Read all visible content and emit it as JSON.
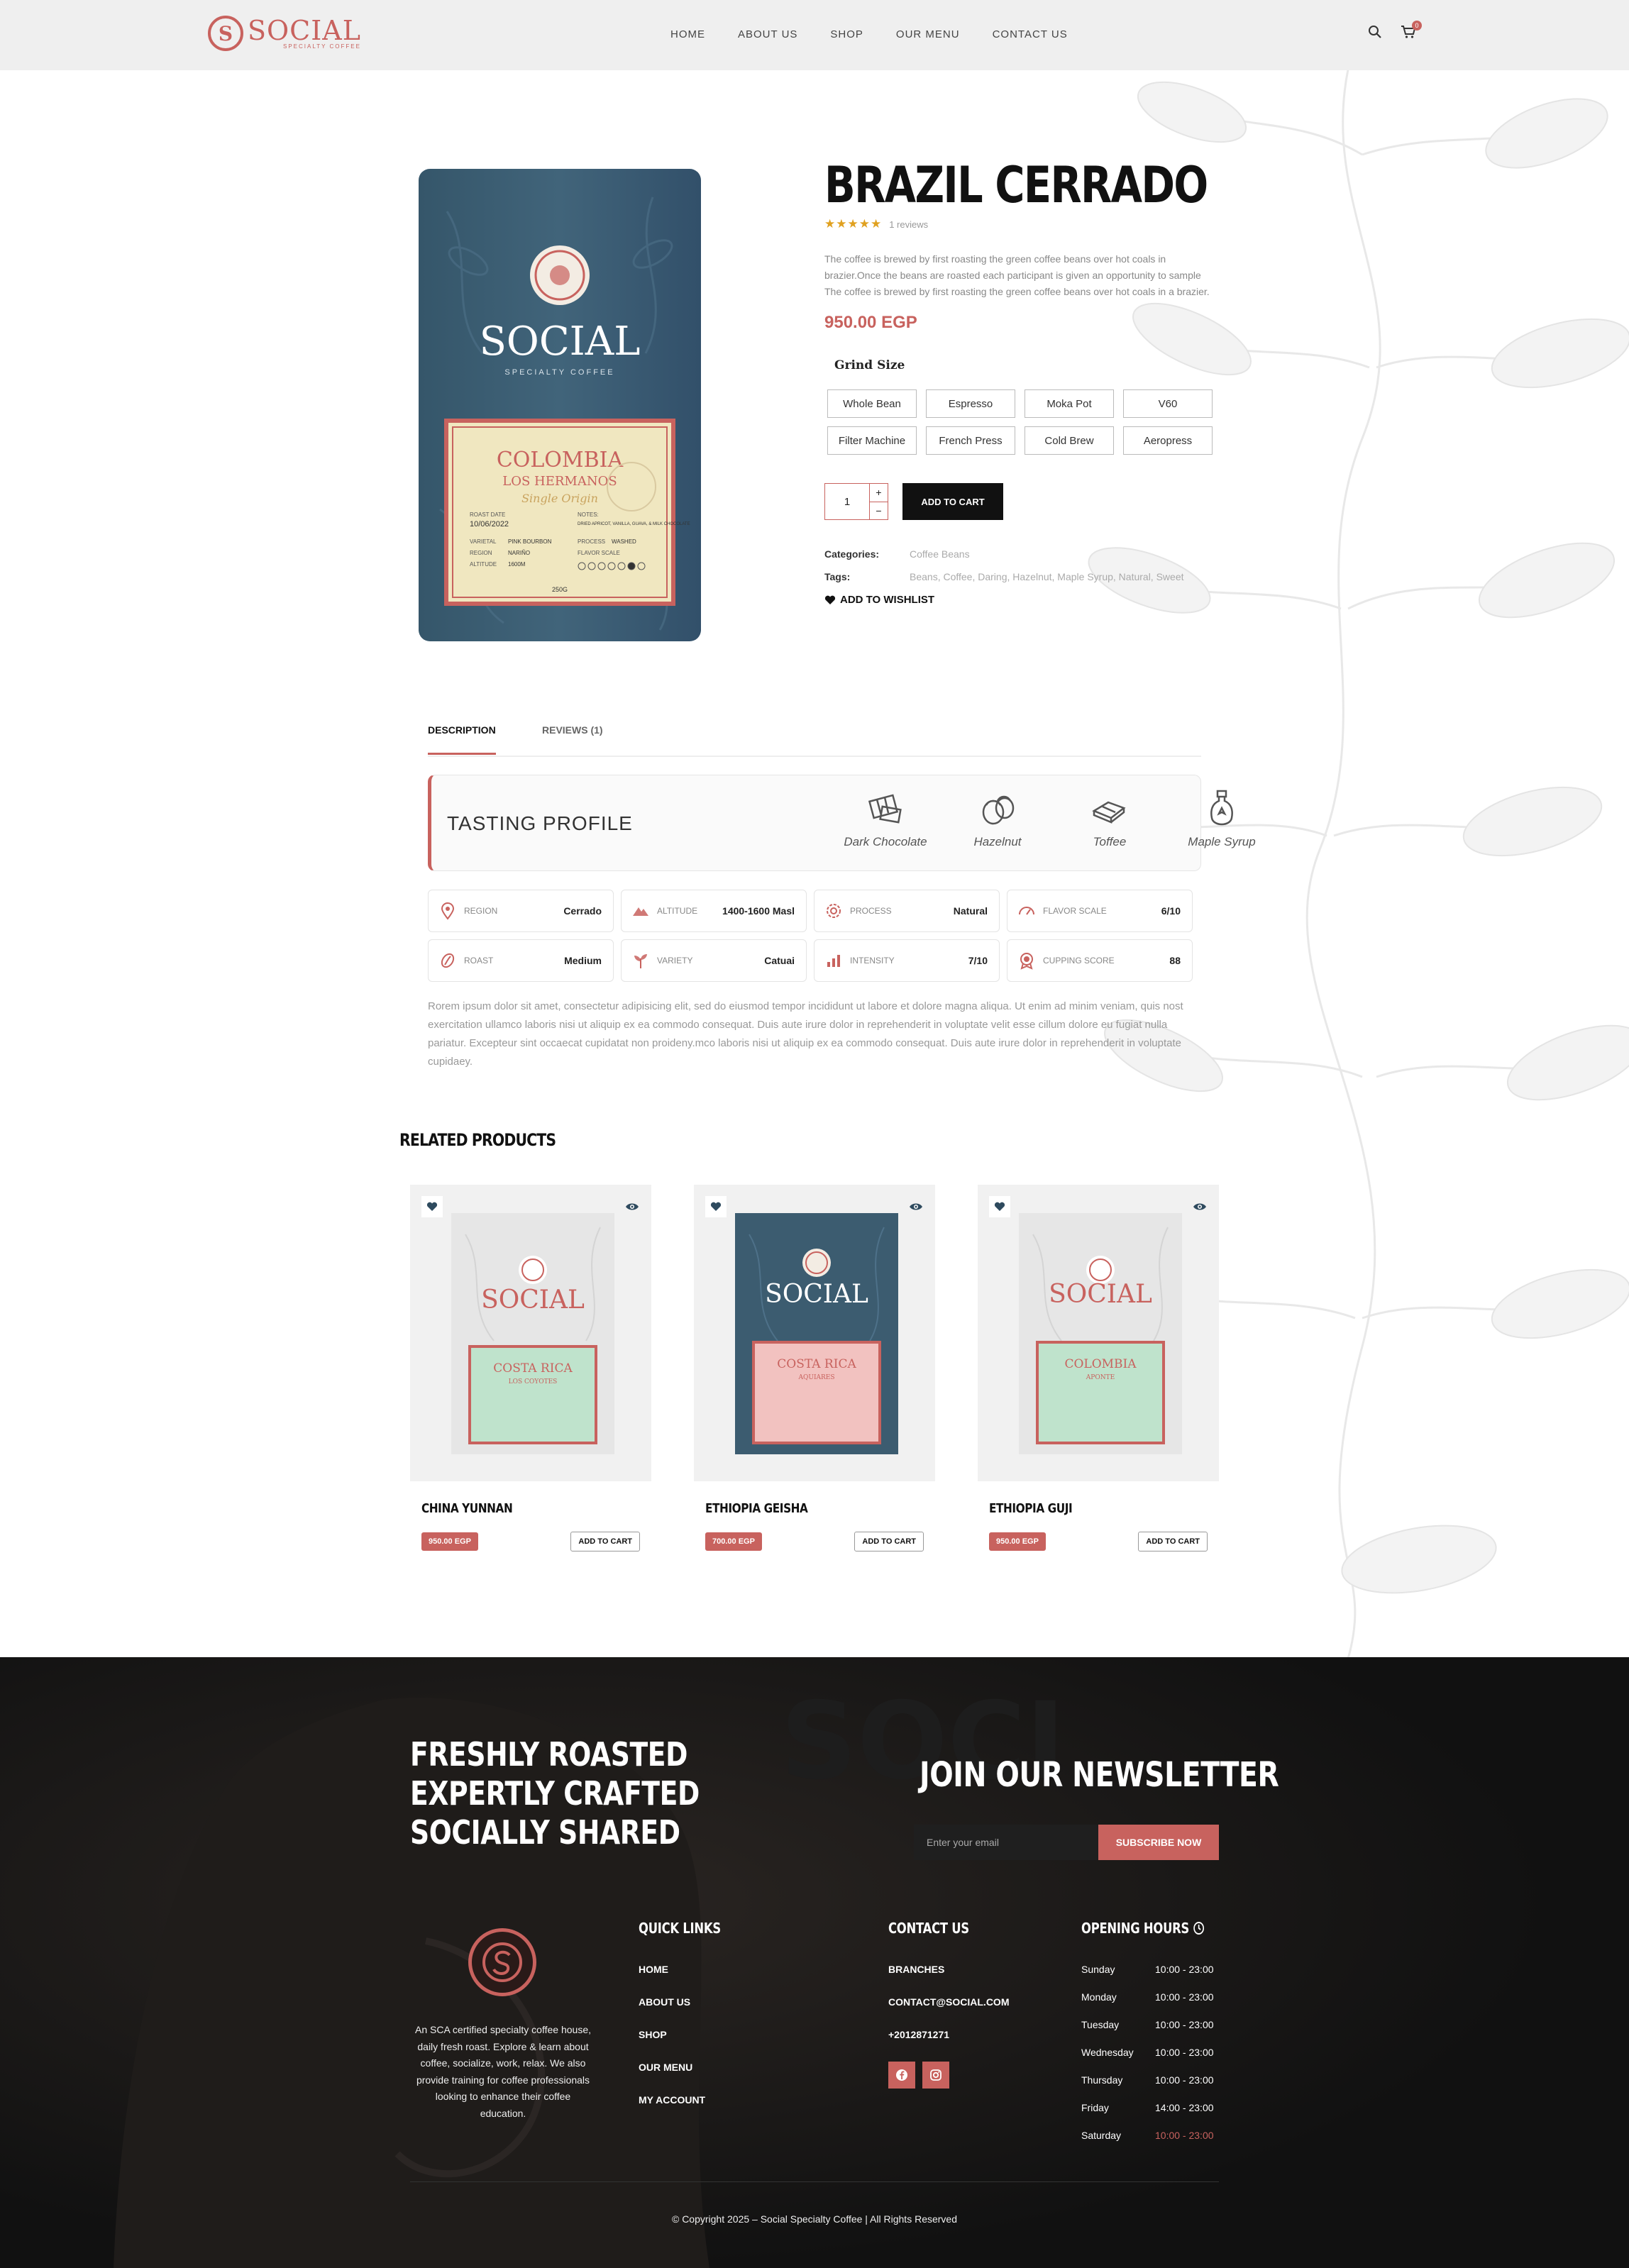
{
  "colors": {
    "accent": "#c8625e",
    "dark": "#111111",
    "star": "#e0a120",
    "bag_blue": "#3c5c70",
    "label_cream": "#f0e7c0",
    "footer_bg": "#141414"
  },
  "header": {
    "brand": "SOCIAL",
    "brand_sub": "SPECIALTY COFFEE",
    "nav": [
      "HOME",
      "ABOUT US",
      "SHOP",
      "OUR MENU",
      "CONTACT US"
    ],
    "cart_count": "0",
    "icons": [
      "search-icon",
      "cart-icon"
    ]
  },
  "product": {
    "title": "BRAZIL CERRADO",
    "stars": "★★★★★",
    "reviews": "1 reviews",
    "short_description": "The coffee is brewed by first roasting the green coffee beans over hot coals in brazier.Once the beans are roasted each participant is given an opportunity to sample The coffee is brewed by first roasting the green coffee beans over hot coals in a brazier.",
    "price": "950.00 EGP",
    "grind_label": "Grind Size",
    "grind_options": [
      "Whole Bean",
      "Espresso",
      "Moka Pot",
      "V60",
      "Filter Machine",
      "French Press",
      "Cold Brew",
      "Aeropress"
    ],
    "quantity": "1",
    "qty_plus": "+",
    "qty_minus": "−",
    "add_to_cart": "ADD TO CART",
    "categories_label": "Categories:",
    "categories": "Coffee Beans",
    "tags_label": "Tags:",
    "tags": "Beans, Coffee, Daring, Hazelnut, Maple Syrup, Natural, Sweet",
    "wishlist": "ADD TO WISHLIST",
    "bag": {
      "brand": "SOCIAL",
      "brand_sub": "SPECIALTY COFFEE",
      "label_title": "COLOMBIA",
      "label_sub": "LOS HERMANOS",
      "label_script": "Single Origin",
      "roast_date_label": "ROAST DATE",
      "roast_date": "10/06/2022",
      "notes_label": "NOTES:",
      "notes": "DRIED APRICOT, VANILLA, GUAVA, & MILK CHOCOLATE",
      "varietal_label": "VARIETAL",
      "varietal": "PINK BOURBON",
      "region_label": "REGION",
      "region": "NARIÑO",
      "altitude_label": "ALTITUDE",
      "altitude": "1600M",
      "process_label": "PROCESS",
      "process": "WASHED",
      "flavor_label": "FLAVOR SCALE",
      "weight": "250G"
    }
  },
  "tabs": [
    {
      "label": "DESCRIPTION",
      "active": true
    },
    {
      "label": "REVIEWS (1)",
      "active": false
    }
  ],
  "tasting": {
    "title": "TASTING PROFILE",
    "notes": [
      {
        "label": "Dark Chocolate",
        "icon": "chocolate-icon"
      },
      {
        "label": "Hazelnut",
        "icon": "hazelnut-icon"
      },
      {
        "label": "Toffee",
        "icon": "toffee-icon"
      },
      {
        "label": "Maple Syrup",
        "icon": "maple-syrup-icon"
      }
    ]
  },
  "attributes": [
    {
      "key": "REGION",
      "value": "Cerrado",
      "icon": "location-icon"
    },
    {
      "key": "ALTITUDE",
      "value": "1400-1600 Masl",
      "icon": "mountain-icon"
    },
    {
      "key": "PROCESS",
      "value": "Natural",
      "icon": "process-icon"
    },
    {
      "key": "FLAVOR SCALE",
      "value": "6/10",
      "icon": "scale-icon"
    },
    {
      "key": "ROAST",
      "value": "Medium",
      "icon": "bean-icon"
    },
    {
      "key": "VARIETY",
      "value": "Catuai",
      "icon": "plant-icon"
    },
    {
      "key": "INTENSITY",
      "value": "7/10",
      "icon": "chart-icon"
    },
    {
      "key": "CUPPING SCORE",
      "value": "88",
      "icon": "badge-icon"
    }
  ],
  "description": "Rorem ipsum dolor sit amet, consectetur adipisicing elit, sed do eiusmod tempor incididunt ut labore et dolore magna aliqua. Ut enim ad minim veniam, quis nost exercitation ullamco laboris nisi ut aliquip ex ea commodo consequat. Duis aute irure dolor in reprehenderit in voluptate velit esse cillum dolore eu fugiat nulla pariatur. Excepteur sint occaecat cupidatat non proideny.mco laboris nisi ut aliquip ex ea commodo consequat. Duis aute irure dolor in reprehenderit in voluptate cupidaey.",
  "related": {
    "title": "RELATED PRODUCTS",
    "items": [
      {
        "name": "CHINA YUNNAN",
        "price": "950.00 EGP",
        "add": "ADD TO CART",
        "bag_style": "white",
        "label_color": "#bfe3cc",
        "label_title": "COSTA RICA",
        "label_sub": "LOS COYOTES"
      },
      {
        "name": "ETHIOPIA GEISHA",
        "price": "700.00 EGP",
        "add": "ADD TO CART",
        "bag_style": "blue",
        "label_color": "#f2c2c0",
        "label_title": "COSTA RICA",
        "label_sub": "AQUIARES"
      },
      {
        "name": "ETHIOPIA GUJI",
        "price": "950.00 EGP",
        "add": "ADD TO CART",
        "bag_style": "white",
        "label_color": "#bfe3cc",
        "label_title": "COLOMBIA",
        "label_sub": "APONTE"
      }
    ]
  },
  "footer": {
    "slogan": [
      "FRESHLY ROASTED",
      "EXPERTLY CRAFTED",
      "SOCIALLY SHARED"
    ],
    "newsletter_title": "JOIN OUR NEWSLETTER",
    "email_placeholder": "Enter your email",
    "subscribe": "SUBSCRIBE NOW",
    "about": "An SCA certified specialty coffee house, daily fresh roast. Explore & learn about coffee, socialize, work, relax. We also provide training for coffee professionals looking to enhance their coffee education.",
    "quick_links_title": "QUICK LINKS",
    "quick_links": [
      "HOME",
      "ABOUT US",
      "SHOP",
      "OUR MENU",
      "MY ACCOUNT"
    ],
    "contact_title": "CONTACT US",
    "contact": [
      "BRANCHES",
      "CONTACT@SOCIAL.COM",
      "+2012871271"
    ],
    "hours_title": "OPENING HOURS",
    "hours": [
      {
        "day": "Sunday",
        "time": "10:00 - 23:00",
        "closed": false
      },
      {
        "day": "Monday",
        "time": "10:00 - 23:00",
        "closed": false
      },
      {
        "day": "Tuesday",
        "time": "10:00 - 23:00",
        "closed": false
      },
      {
        "day": "Wednesday",
        "time": "10:00 - 23:00",
        "closed": false
      },
      {
        "day": "Thursday",
        "time": "10:00 - 23:00",
        "closed": false
      },
      {
        "day": "Friday",
        "time": "14:00 - 23:00",
        "closed": false
      },
      {
        "day": "Saturday",
        "time": "10:00 - 23:00",
        "closed": true
      }
    ],
    "copyright": "© Copyright 2025 – Social Specialty Coffee | All Rights Reserved"
  }
}
